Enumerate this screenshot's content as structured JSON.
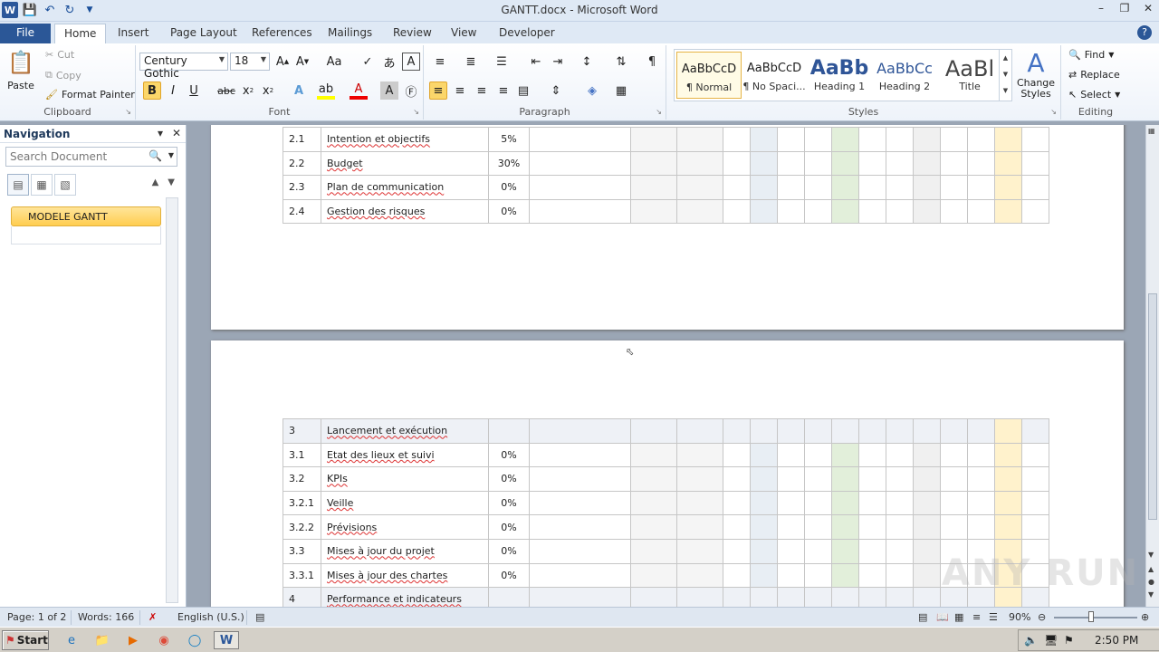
{
  "window": {
    "title": "GANTT.docx - Microsoft Word"
  },
  "ribbon_tabs": [
    "File",
    "Home",
    "Insert",
    "Page Layout",
    "References",
    "Mailings",
    "Review",
    "View",
    "Developer"
  ],
  "clipboard": {
    "paste": "Paste",
    "cut": "Cut",
    "copy": "Copy",
    "format_painter": "Format Painter",
    "label": "Clipboard"
  },
  "font": {
    "name": "Century Gothic",
    "size": "18",
    "label": "Font"
  },
  "paragraph": {
    "label": "Paragraph"
  },
  "styles": {
    "label": "Styles",
    "items": [
      {
        "preview": "AaBbCcD",
        "name": "¶ Normal"
      },
      {
        "preview": "AaBbCcD",
        "name": "¶ No Spaci..."
      },
      {
        "preview": "AaBb",
        "name": "Heading 1"
      },
      {
        "preview": "AaBbCc",
        "name": "Heading 2"
      },
      {
        "preview": "AaBl",
        "name": "Title"
      }
    ],
    "change_styles": "Change Styles"
  },
  "editing": {
    "label": "Editing",
    "find": "Find",
    "replace": "Replace",
    "select": "Select"
  },
  "navigation": {
    "title": "Navigation",
    "search_placeholder": "Search Document",
    "heading": "MODELE GANTT"
  },
  "table_page1": [
    {
      "id": "2.1",
      "task": "Intention et objectifs",
      "pct": "5%"
    },
    {
      "id": "2.2",
      "task": "Budget",
      "pct": "30%"
    },
    {
      "id": "2.3",
      "task": "Plan de communication",
      "pct": "0%"
    },
    {
      "id": "2.4",
      "task": "Gestion des risques",
      "pct": "0%"
    }
  ],
  "table_page2": [
    {
      "id": "3",
      "task": "Lancement et exécution",
      "pct": "",
      "header": true
    },
    {
      "id": "3.1",
      "task": "Etat des lieux et suivi",
      "pct": "0%"
    },
    {
      "id": "3.2",
      "task": "KPIs",
      "pct": "0%"
    },
    {
      "id": "3.2.1",
      "task": "Veille",
      "pct": "0%"
    },
    {
      "id": "3.2.2",
      "task": "Prévisions",
      "pct": "0%"
    },
    {
      "id": "3.3",
      "task": "Mises à jour du projet",
      "pct": "0%"
    },
    {
      "id": "3.3.1",
      "task": "Mises à jour des chartes",
      "pct": "0%"
    },
    {
      "id": "4",
      "task": "Performance et indicateurs",
      "pct": "",
      "header": true
    }
  ],
  "status": {
    "page": "Page: 1 of 2",
    "words": "Words: 166",
    "language": "English (U.S.)",
    "zoom": "90%"
  },
  "taskbar": {
    "start": "Start",
    "time": "2:50 PM"
  },
  "watermark": "ANY RUN"
}
